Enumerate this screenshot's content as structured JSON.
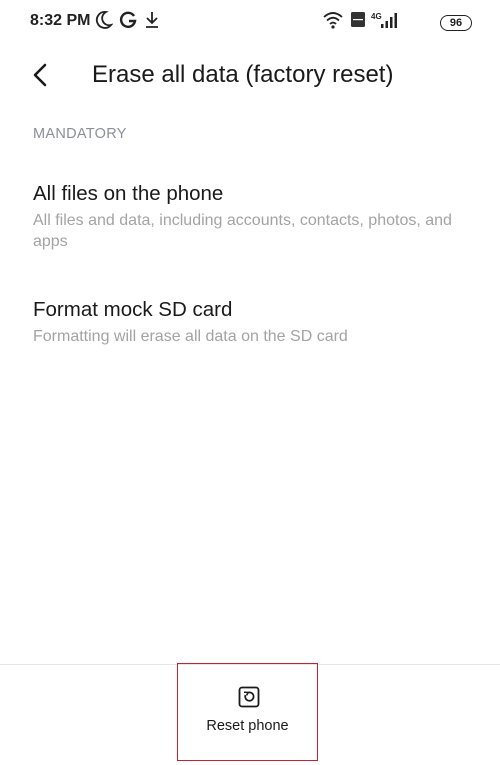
{
  "status_bar": {
    "time": "8:32 PM",
    "battery": "96",
    "network_label": "4G",
    "left_icons": [
      "moon-icon",
      "google-icon",
      "download-icon"
    ],
    "right_icons": [
      "wifi-icon",
      "volte-icon",
      "signal-icon",
      "battery-icon"
    ]
  },
  "header": {
    "back_icon": "chevron-left-icon",
    "title": "Erase all data (factory reset)"
  },
  "section": {
    "label": "MANDATORY"
  },
  "options": [
    {
      "title": "All files on the phone",
      "description": "All files and data, including accounts, contacts, photos, and apps"
    },
    {
      "title": "Format mock SD card",
      "description": "Formatting will erase all data on the SD card"
    }
  ],
  "bottom_action": {
    "icon": "reset-icon",
    "label": "Reset phone",
    "highlight_color": "#c8232c"
  }
}
